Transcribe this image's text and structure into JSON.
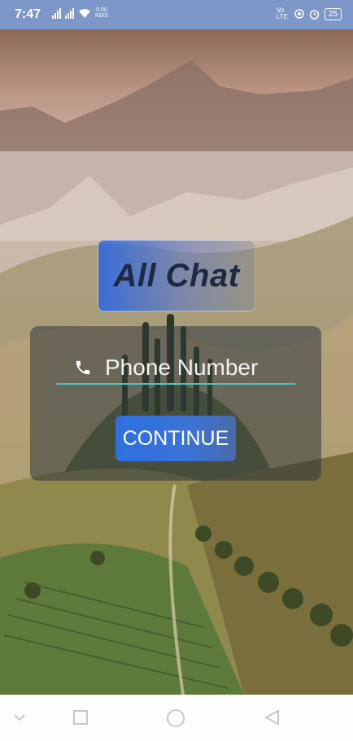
{
  "status_bar": {
    "time": "7:47",
    "network_speed_value": "0.00",
    "network_speed_unit": "KB/S",
    "volte_label": "Vo LTE",
    "battery": "25"
  },
  "app": {
    "title": "All Chat"
  },
  "login": {
    "phone_placeholder": "Phone Number",
    "continue_label": "CONTINUE"
  },
  "icons": {
    "phone": "phone-icon",
    "back": "back-icon",
    "home": "home-icon",
    "recents": "recents-icon",
    "nav_down": "chevron-down-icon"
  }
}
